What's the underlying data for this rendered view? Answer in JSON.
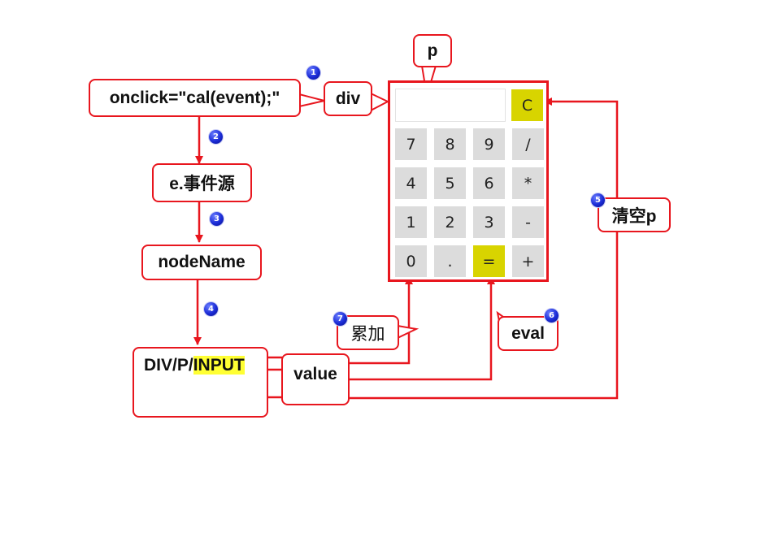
{
  "boxes": {
    "onclick": "onclick=\"cal(event);\"",
    "div": "div",
    "p": "p",
    "event_source": "e.事件源",
    "node_name": "nodeName",
    "div_p": "DIV/P/",
    "input": "INPUT",
    "value": "value",
    "eval": "eval",
    "accumulate": "累加",
    "clear_p": "清空p"
  },
  "badges": [
    "1",
    "2",
    "3",
    "4",
    "5",
    "6",
    "7"
  ],
  "calculator": {
    "clear": "C",
    "keys": [
      "7",
      "8",
      "9",
      "/",
      "4",
      "5",
      "6",
      "*",
      "1",
      "2",
      "3",
      "-",
      "0",
      ".",
      "=",
      "+"
    ]
  },
  "colors": {
    "line": "#e8161e",
    "key": "#dcdcdc",
    "accent_key": "#d8d400",
    "highlight": "#ffff33",
    "badge": "#1a2bd6"
  }
}
